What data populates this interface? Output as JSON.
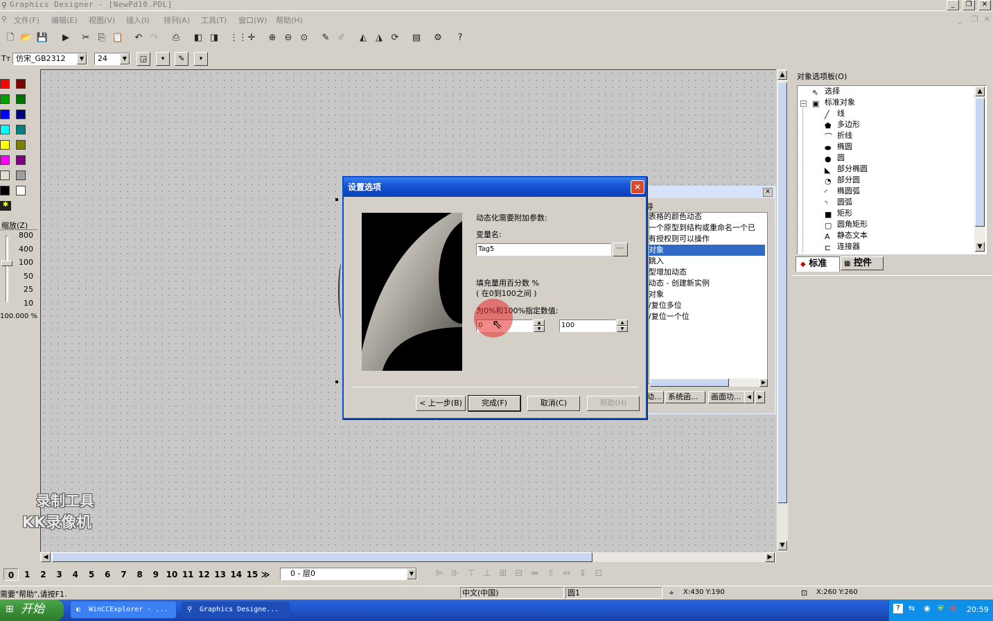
{
  "window": {
    "title": "Graphics Designer - [NewPd10.PDL]"
  },
  "menu": [
    "文件(F)",
    "编辑(E)",
    "视图(V)",
    "插入(I)",
    "排列(A)",
    "工具(T)",
    "窗口(W)",
    "帮助(H)"
  ],
  "font_bar": {
    "font": "仿宋_GB2312",
    "size": "24"
  },
  "zoom": {
    "label": "缩放(Z)",
    "levels": [
      "800",
      "400",
      "100",
      "50",
      "25",
      "10"
    ],
    "value": "100.000 %"
  },
  "palette_colors": [
    "#ff0000",
    "#800000",
    "#00a000",
    "#007000",
    "#0000ff",
    "#000080",
    "#00ffff",
    "#008080",
    "#ffff00",
    "#808000",
    "#ff00ff",
    "#800080",
    "#e0dcd0",
    "#a0a0a0",
    "#000000",
    "#ffffff"
  ],
  "object_palette": {
    "title": "对象选项板(O)",
    "items": [
      "选择",
      "标准对象",
      "线",
      "多边形",
      "折线",
      "椭圆",
      "圆",
      "部分椭圆",
      "部分圆",
      "椭圆弧",
      "圆弧",
      "矩形",
      "圆角矩形",
      "静态文本",
      "连接器"
    ],
    "tabs": [
      "标准",
      "控件"
    ]
  },
  "background_dialog": {
    "header": "导",
    "items": [
      "表格的颜色动态",
      "一个原型到结构或重命名一个已",
      "有授权则可以操作",
      "对象",
      "跳入",
      "型增加动态",
      "动态 - 创建新实例",
      "对象",
      "/复位多位",
      "/复位一个位"
    ],
    "selected_index": 3,
    "tabs": [
      "动...",
      "系统函...",
      "画面功..."
    ]
  },
  "dialog": {
    "title": "设置选项",
    "intro": "动态化需要附加参数:",
    "var_label": "变量名:",
    "var_value": "Tag5",
    "fill_label": "填充量用百分数 %",
    "fill_range": "( 在0到100之间 )",
    "spec_label": "为0%和100%指定数值:",
    "min_value": "0",
    "max_value": "100",
    "buttons": {
      "back": "< 上一步(B)",
      "finish": "完成(F)",
      "cancel": "取消(C)",
      "help": "帮助(H)"
    }
  },
  "layers": {
    "buttons": [
      "0",
      "1",
      "2",
      "3",
      "4",
      "5",
      "6",
      "7",
      "8",
      "9",
      "10",
      "11",
      "12",
      "13",
      "14",
      "15"
    ],
    "current": "0 - 层0"
  },
  "status": {
    "hint": "需要\"帮助\",请按F1.",
    "lang": "中文(中国)",
    "object": "圆1",
    "pos": "X:430 Y:190",
    "size": "X:260 Y:260"
  },
  "watermark": {
    "line1": "录制工具",
    "line2": "KK录像机"
  },
  "taskbar": {
    "start": "开始",
    "tasks": [
      "WinCCExplorer - ...",
      "Graphics Designe..."
    ],
    "clock": "20:59"
  }
}
